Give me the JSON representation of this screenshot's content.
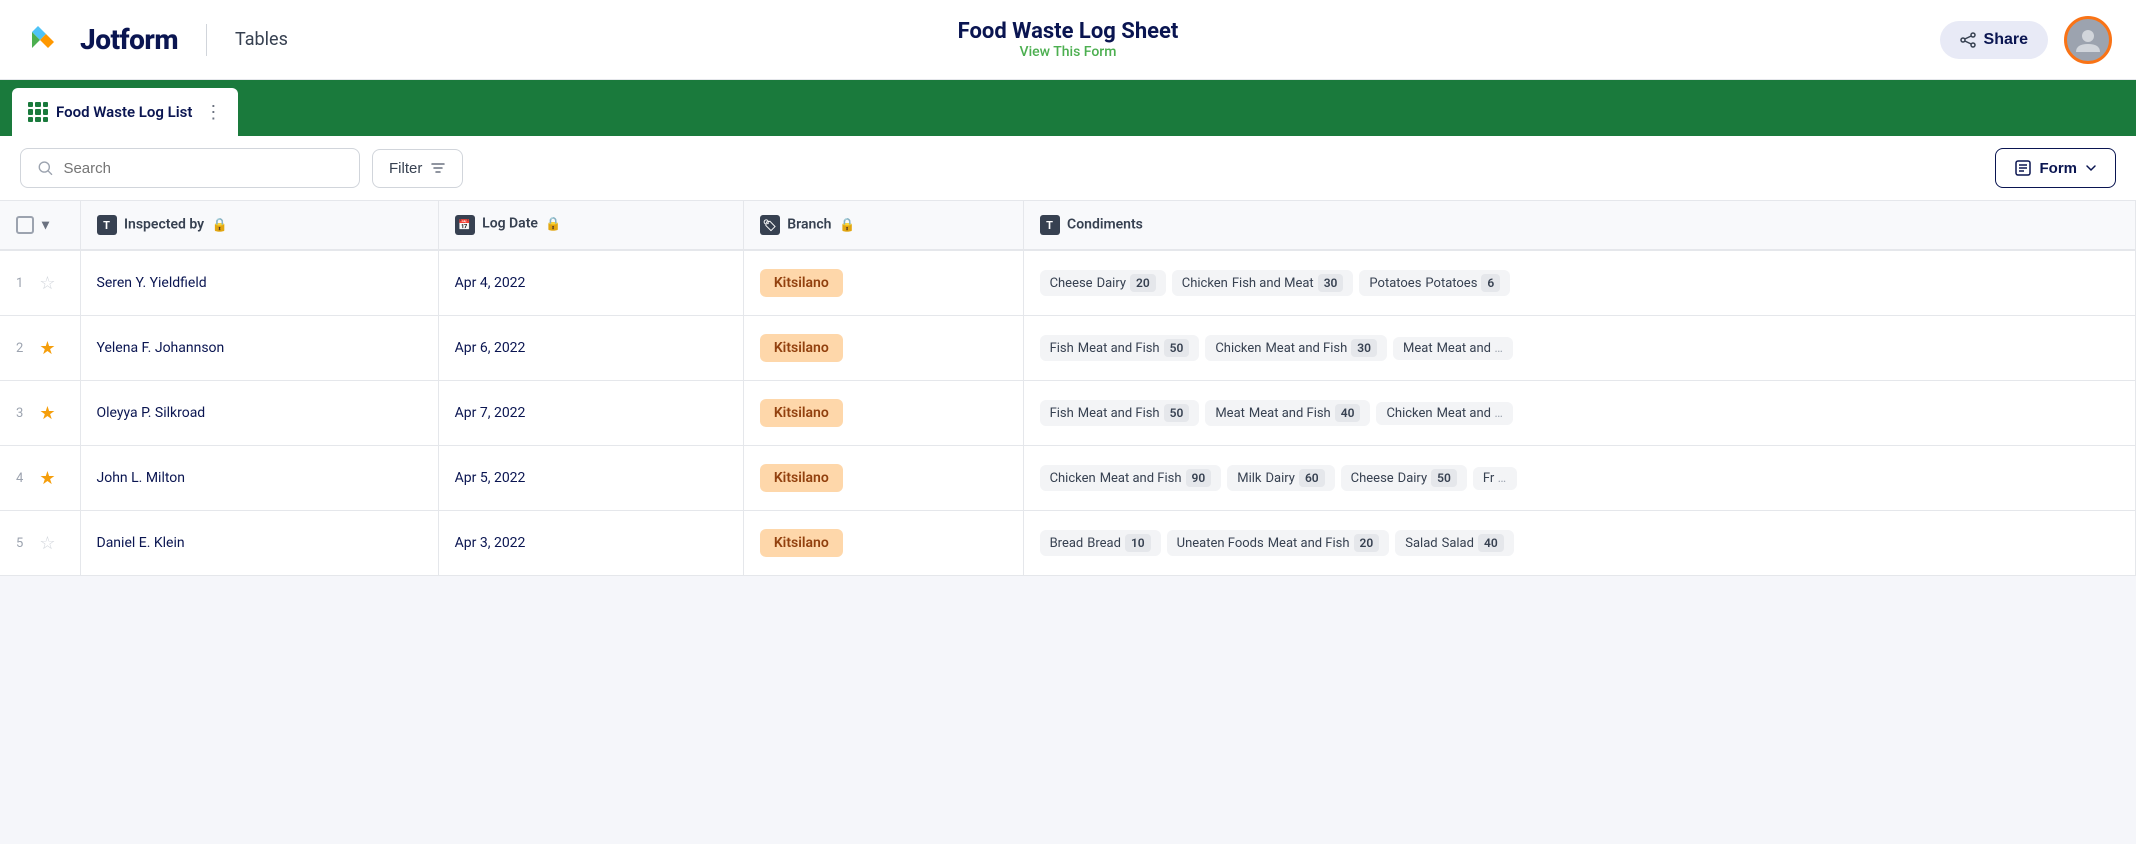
{
  "header": {
    "logo_text": "Jotform",
    "tables_label": "Tables",
    "title": "Food Waste Log Sheet",
    "subtitle": "View This Form",
    "share_label": "Share",
    "avatar_alt": "user avatar"
  },
  "tab": {
    "label": "Food Waste Log List",
    "dots": "⋮"
  },
  "toolbar": {
    "search_placeholder": "Search",
    "filter_label": "Filter",
    "form_label": "Form"
  },
  "table": {
    "columns": [
      {
        "id": "row_controls",
        "label": ""
      },
      {
        "id": "inspected_by",
        "label": "Inspected by",
        "icon": "T",
        "locked": true
      },
      {
        "id": "log_date",
        "label": "Log Date",
        "icon": "cal",
        "locked": true
      },
      {
        "id": "branch",
        "label": "Branch",
        "icon": "tag",
        "locked": true
      },
      {
        "id": "condiments",
        "label": "Condiments",
        "icon": "T",
        "locked": false
      }
    ],
    "rows": [
      {
        "num": "1",
        "starred": false,
        "inspected_by": "Seren Y. Yieldfield",
        "log_date": "Apr 4, 2022",
        "branch": "Kitsilano",
        "condiments": [
          {
            "name": "Cheese",
            "category": "Dairy",
            "amount": "20"
          },
          {
            "name": "Chicken",
            "category": "Fish and Meat",
            "amount": "30"
          },
          {
            "name": "Potatoes",
            "category": "Potatoes",
            "amount": "6"
          }
        ]
      },
      {
        "num": "2",
        "starred": true,
        "inspected_by": "Yelena F. Johannson",
        "log_date": "Apr 6, 2022",
        "branch": "Kitsilano",
        "condiments": [
          {
            "name": "Fish",
            "category": "Meat and Fish",
            "amount": "50"
          },
          {
            "name": "Chicken",
            "category": "Meat and Fish",
            "amount": "30"
          },
          {
            "name": "Meat",
            "category": "Meat and",
            "amount": ""
          }
        ]
      },
      {
        "num": "3",
        "starred": true,
        "inspected_by": "Oleyya P. Silkroad",
        "log_date": "Apr 7, 2022",
        "branch": "Kitsilano",
        "condiments": [
          {
            "name": "Fish",
            "category": "Meat and Fish",
            "amount": "50"
          },
          {
            "name": "Meat",
            "category": "Meat and Fish",
            "amount": "40"
          },
          {
            "name": "Chicken",
            "category": "Meat and",
            "amount": ""
          }
        ]
      },
      {
        "num": "4",
        "starred": true,
        "inspected_by": "John L. Milton",
        "log_date": "Apr 5, 2022",
        "branch": "Kitsilano",
        "condiments": [
          {
            "name": "Chicken",
            "category": "Meat and Fish",
            "amount": "90"
          },
          {
            "name": "Milk",
            "category": "Dairy",
            "amount": "60"
          },
          {
            "name": "Cheese",
            "category": "Dairy",
            "amount": "50"
          },
          {
            "name": "Fr",
            "category": "",
            "amount": ""
          }
        ]
      },
      {
        "num": "5",
        "starred": false,
        "inspected_by": "Daniel E. Klein",
        "log_date": "Apr 3, 2022",
        "branch": "Kitsilano",
        "condiments": [
          {
            "name": "Bread",
            "category": "Bread",
            "amount": "10"
          },
          {
            "name": "Uneaten Foods",
            "category": "Meat and Fish",
            "amount": "20"
          },
          {
            "name": "Salad",
            "category": "Salad",
            "amount": "40"
          }
        ]
      }
    ]
  }
}
